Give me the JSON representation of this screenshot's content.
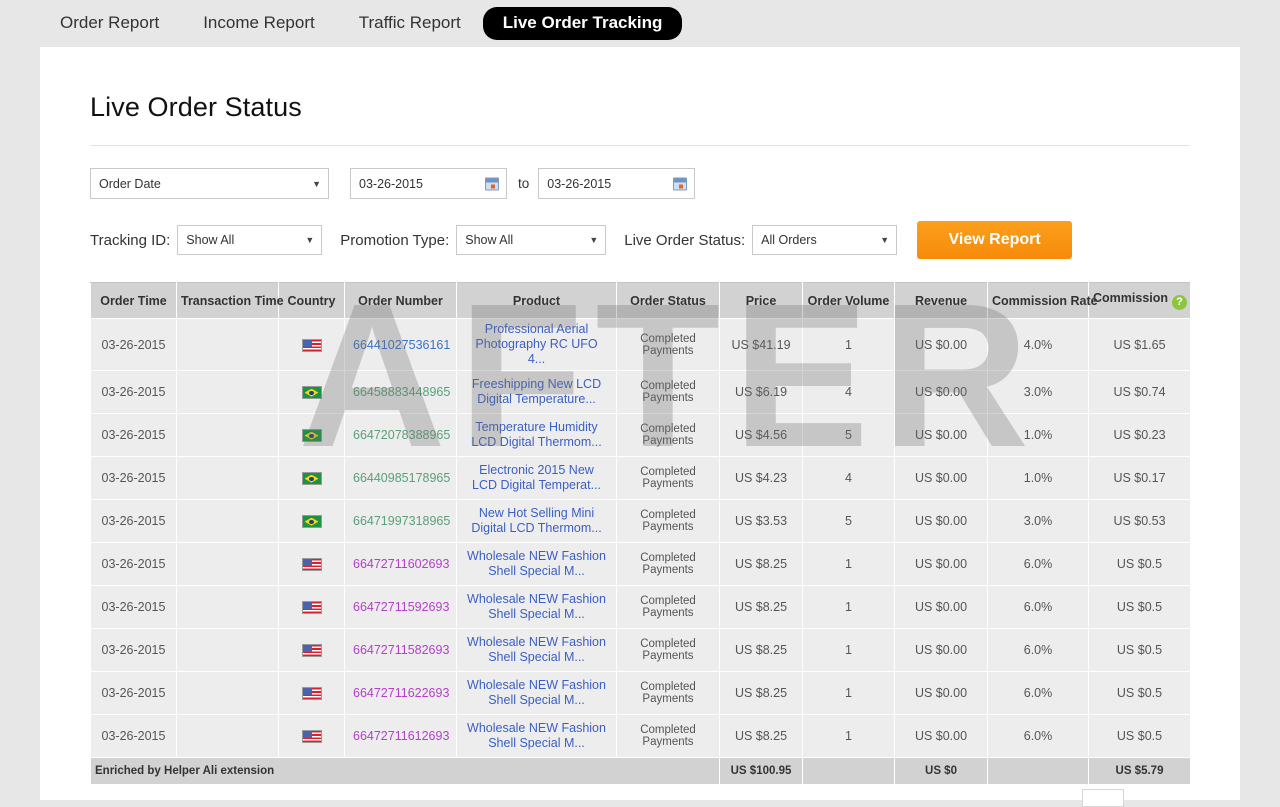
{
  "nav": {
    "tabs": [
      {
        "label": "Order Report",
        "active": false
      },
      {
        "label": "Income Report",
        "active": false
      },
      {
        "label": "Traffic Report",
        "active": false
      },
      {
        "label": "Live Order Tracking",
        "active": true
      }
    ]
  },
  "page": {
    "title": "Live Order Status"
  },
  "filters": {
    "date_type": {
      "value": "Order Date"
    },
    "date_from": {
      "value": "03-26-2015"
    },
    "date_to": {
      "value": "03-26-2015"
    },
    "to_label": "to",
    "tracking_id": {
      "label": "Tracking ID:",
      "value": "Show All"
    },
    "promotion_type": {
      "label": "Promotion Type:",
      "value": "Show All"
    },
    "live_order_status": {
      "label": "Live Order Status:",
      "value": "All Orders"
    },
    "view_report_button": "View Report"
  },
  "table": {
    "columns": [
      "Order Time",
      "Transaction Time",
      "Country",
      "Order Number",
      "Product",
      "Order Status",
      "Price",
      "Order Volume",
      "Revenue",
      "Commission Rate",
      "Commission"
    ],
    "commission_help_icon": "?",
    "rows": [
      {
        "order_time": "03-26-2015",
        "transaction_time": "",
        "country": "us",
        "order_number": "66441027536161",
        "order_number_color": "blue",
        "product": "Professional Aerial Photography RC UFO 4...",
        "order_status": "Completed Payments",
        "price": "US $41.19",
        "order_volume": "1",
        "revenue": "US $0.00",
        "commission_rate": "4.0%",
        "commission": "US $1.65"
      },
      {
        "order_time": "03-26-2015",
        "transaction_time": "",
        "country": "br",
        "order_number": "66458883448965",
        "order_number_color": "green",
        "product": "Freeshipping New LCD Digital Temperature...",
        "order_status": "Completed Payments",
        "price": "US $6.19",
        "order_volume": "4",
        "revenue": "US $0.00",
        "commission_rate": "3.0%",
        "commission": "US $0.74"
      },
      {
        "order_time": "03-26-2015",
        "transaction_time": "",
        "country": "br",
        "order_number": "66472078388965",
        "order_number_color": "green",
        "product": "Temperature Humidity LCD Digital Thermom...",
        "order_status": "Completed Payments",
        "price": "US $4.56",
        "order_volume": "5",
        "revenue": "US $0.00",
        "commission_rate": "1.0%",
        "commission": "US $0.23"
      },
      {
        "order_time": "03-26-2015",
        "transaction_time": "",
        "country": "br",
        "order_number": "66440985178965",
        "order_number_color": "green",
        "product": "Electronic 2015 New LCD Digital Temperat...",
        "order_status": "Completed Payments",
        "price": "US $4.23",
        "order_volume": "4",
        "revenue": "US $0.00",
        "commission_rate": "1.0%",
        "commission": "US $0.17"
      },
      {
        "order_time": "03-26-2015",
        "transaction_time": "",
        "country": "br",
        "order_number": "66471997318965",
        "order_number_color": "green",
        "product": "New Hot Selling Mini Digital LCD Thermom...",
        "order_status": "Completed Payments",
        "price": "US $3.53",
        "order_volume": "5",
        "revenue": "US $0.00",
        "commission_rate": "3.0%",
        "commission": "US $0.53"
      },
      {
        "order_time": "03-26-2015",
        "transaction_time": "",
        "country": "us",
        "order_number": "66472711602693",
        "order_number_color": "purple",
        "product": "Wholesale NEW Fashion Shell Special M...",
        "order_status": "Completed Payments",
        "price": "US $8.25",
        "order_volume": "1",
        "revenue": "US $0.00",
        "commission_rate": "6.0%",
        "commission": "US $0.5"
      },
      {
        "order_time": "03-26-2015",
        "transaction_time": "",
        "country": "us",
        "order_number": "66472711592693",
        "order_number_color": "purple",
        "product": "Wholesale NEW Fashion Shell Special M...",
        "order_status": "Completed Payments",
        "price": "US $8.25",
        "order_volume": "1",
        "revenue": "US $0.00",
        "commission_rate": "6.0%",
        "commission": "US $0.5"
      },
      {
        "order_time": "03-26-2015",
        "transaction_time": "",
        "country": "us",
        "order_number": "66472711582693",
        "order_number_color": "purple",
        "product": "Wholesale NEW Fashion Shell Special M...",
        "order_status": "Completed Payments",
        "price": "US $8.25",
        "order_volume": "1",
        "revenue": "US $0.00",
        "commission_rate": "6.0%",
        "commission": "US $0.5"
      },
      {
        "order_time": "03-26-2015",
        "transaction_time": "",
        "country": "us",
        "order_number": "66472711622693",
        "order_number_color": "purple",
        "product": "Wholesale NEW Fashion Shell Special M...",
        "order_status": "Completed Payments",
        "price": "US $8.25",
        "order_volume": "1",
        "revenue": "US $0.00",
        "commission_rate": "6.0%",
        "commission": "US $0.5"
      },
      {
        "order_time": "03-26-2015",
        "transaction_time": "",
        "country": "us",
        "order_number": "66472711612693",
        "order_number_color": "purple",
        "product": "Wholesale NEW Fashion Shell Special M...",
        "order_status": "Completed Payments",
        "price": "US $8.25",
        "order_volume": "1",
        "revenue": "US $0.00",
        "commission_rate": "6.0%",
        "commission": "US $0.5"
      }
    ],
    "totals": {
      "label": "Enriched by Helper Ali extension",
      "price": "US $100.95",
      "order_volume": "",
      "revenue": "US $0",
      "commission_rate": "",
      "commission": "US $5.79"
    }
  },
  "watermark": {
    "text": "AFTER"
  },
  "colors": {
    "accent_orange": "#f78b0b",
    "status_orange": "#ef6a28",
    "help_green": "#8cc63e",
    "header_gray": "#d2d2d2",
    "row_gray": "#ededed",
    "page_bg": "#e7e7e7"
  }
}
